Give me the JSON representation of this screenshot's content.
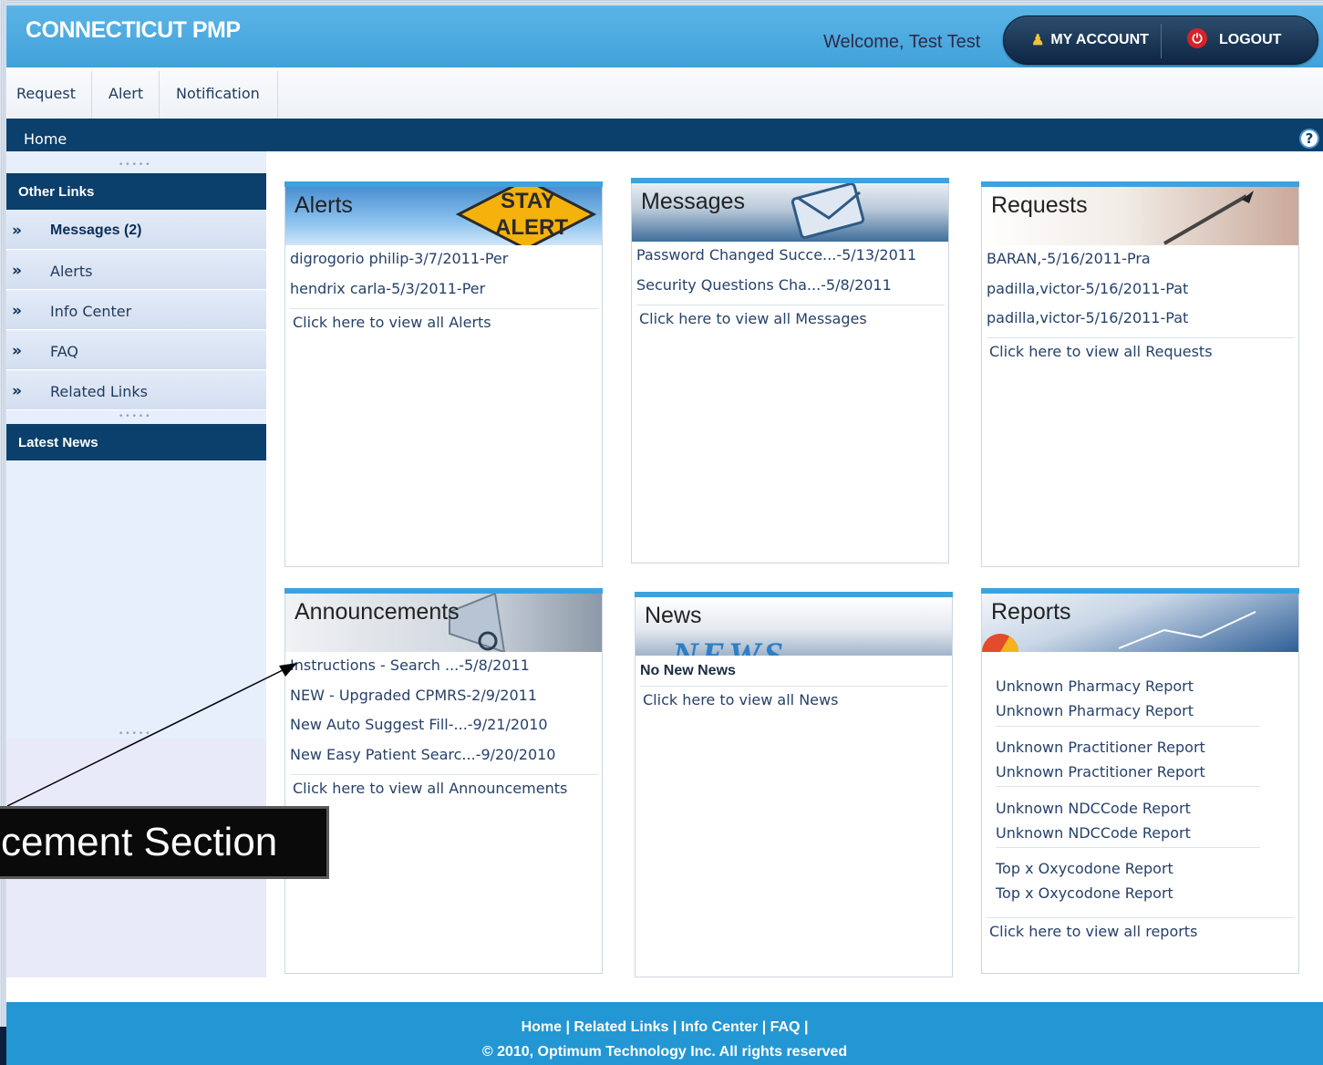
{
  "app": {
    "brand": "CONNECTICUT PMP",
    "welcome": "Welcome, Test Test"
  },
  "account": {
    "my_account": "MY ACCOUNT",
    "logout": "LOGOUT"
  },
  "menu": [
    "Request",
    "Alert",
    "Notification"
  ],
  "nav": {
    "home": "Home",
    "help": "?"
  },
  "sidebar": {
    "other_links_title": "Other Links",
    "items": [
      {
        "label": "Messages (2)"
      },
      {
        "label": "Alerts"
      },
      {
        "label": "Info Center"
      },
      {
        "label": "FAQ"
      },
      {
        "label": "Related Links"
      }
    ],
    "latest_news_title": "Latest News"
  },
  "alerts": {
    "title": "Alerts",
    "sign_line1": "STAY",
    "sign_line2": "ALERT",
    "items": [
      "digrogorio philip-3/7/2011-Per",
      "hendrix carla-5/3/2011-Per"
    ],
    "view_all": "Click here to view all Alerts"
  },
  "messages": {
    "title": "Messages",
    "items": [
      "Password Changed Succe...-5/13/2011",
      "Security Questions Cha...-5/8/2011"
    ],
    "view_all": "Click here to view all Messages"
  },
  "requests": {
    "title": "Requests",
    "items": [
      "BARAN,-5/16/2011-Pra",
      "padilla,victor-5/16/2011-Pat",
      "padilla,victor-5/16/2011-Pat"
    ],
    "view_all": "Click here to view all Requests"
  },
  "announcements": {
    "title": "Announcements",
    "items": [
      "Instructions - Search ...-5/8/2011",
      "NEW - Upgraded CPMRS-2/9/2011",
      "New Auto Suggest Fill-...-9/21/2010",
      "New Easy Patient Searc...-9/20/2010"
    ],
    "view_all": "Click here to view all Announcements"
  },
  "news": {
    "title": "News",
    "banner_text": "NEWS",
    "empty": "No New News",
    "view_all": "Click here to view all News"
  },
  "reports": {
    "title": "Reports",
    "groups": [
      [
        "Unknown Pharmacy Report",
        "Unknown Pharmacy Report"
      ],
      [
        "Unknown Practitioner Report",
        "Unknown Practitioner Report"
      ],
      [
        "Unknown NDCCode Report",
        "Unknown NDCCode Report"
      ],
      [
        "Top x Oxycodone Report",
        "Top x Oxycodone Report"
      ]
    ],
    "view_all": "Click here to view all reports"
  },
  "footer": {
    "links": "Home | Related Links | Info Center | FAQ |",
    "copyright": "© 2010, Optimum Technology Inc. All rights reserved"
  },
  "callout": {
    "text": "cement Section"
  },
  "colors": {
    "header": "#41a2da",
    "navy": "#0b3f6c",
    "accent": "#3ea2de",
    "footer": "#2397d4"
  }
}
